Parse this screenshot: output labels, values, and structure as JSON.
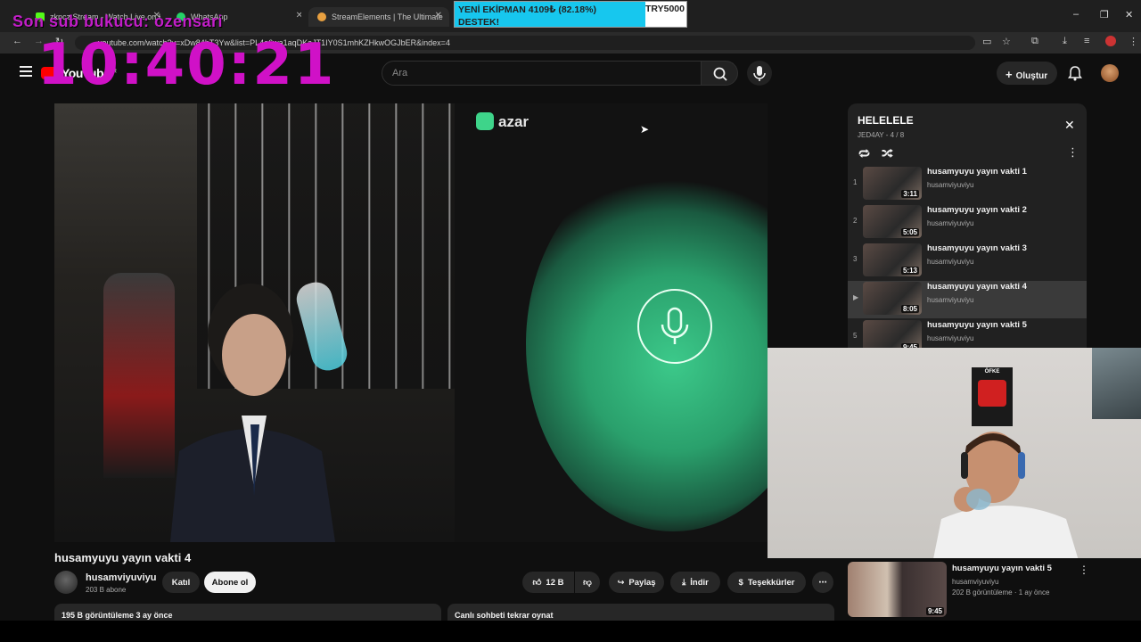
{
  "browser": {
    "tabs": [
      {
        "title": "zkncz Stream - Watch Live on K",
        "icon_color": "#53fc18"
      },
      {
        "title": "WhatsApp",
        "icon_color": "#25d366"
      },
      {
        "title": "StreamElements | The Ultimate",
        "icon_color": "#e8a040"
      }
    ],
    "url": "youtube.com/watch?v=xDw84bT3Yw&list=PL4e6wa1aqDKaJT1IY0S1mhKZHkwOGJbER&index=4",
    "window_controls": {
      "minimize": "–",
      "restore": "❐",
      "close": "✕"
    }
  },
  "overlays": {
    "sub_ticker": "Son sub bukucu: ozensari",
    "clock": "10:40:21",
    "donation": {
      "line1": "YENİ EKİPMAN 4109₺ (82.18%)",
      "line2": "DESTEK!",
      "goal": "TRY5000",
      "progress": 0.8218,
      "bar_color": "#17c7ee"
    }
  },
  "youtube": {
    "logo_text": "YouTube",
    "logo_region": "TR",
    "search_placeholder": "Ara",
    "create_label": "Oluştur",
    "video": {
      "title": "husamyuyu yayın vakti 4",
      "channel": "husamviyuviyu",
      "subscribers": "203 B abone",
      "join_label": "Katıl",
      "subscribe_label": "Abone ol",
      "likes": "12 B",
      "share_label": "Paylaş",
      "download_label": "İndir",
      "thanks_label": "Teşekkürler",
      "views_line": "195 B görüntüleme  3 ay önce",
      "replay_label": "Canlı sohbeti tekrar oynat",
      "azar_logo": "azar"
    },
    "playlist": {
      "title": "HELELELE",
      "meta": "JED4AY - 4 / 8",
      "items": [
        {
          "index": "1",
          "title": "husamyuyu yayın vakti 1",
          "channel": "husamviyuviyu",
          "duration": "3:11",
          "active": false
        },
        {
          "index": "2",
          "title": "husamyuyu yayın vakti 2",
          "channel": "husamviyuviyu",
          "duration": "5:05",
          "active": false
        },
        {
          "index": "3",
          "title": "husamyuyu yayın vakti 3",
          "channel": "husamviyuviyu",
          "duration": "5:13",
          "active": false
        },
        {
          "index": "▶",
          "title": "husamyuyu yayın vakti 4",
          "channel": "husamviyuviyu",
          "duration": "8:05",
          "active": true
        },
        {
          "index": "5",
          "title": "husamyuyu yayın vakti 5",
          "channel": "husamviyuviyu",
          "duration": "9:45",
          "active": false
        }
      ]
    },
    "next_video": {
      "title": "husamyuyu yayın vakti 5",
      "channel": "husamviyuviyu",
      "meta": "202 B görüntüleme · 1 ay önce",
      "duration": "9:45"
    },
    "facecam": {
      "poster_label": "ÖFKE"
    }
  }
}
